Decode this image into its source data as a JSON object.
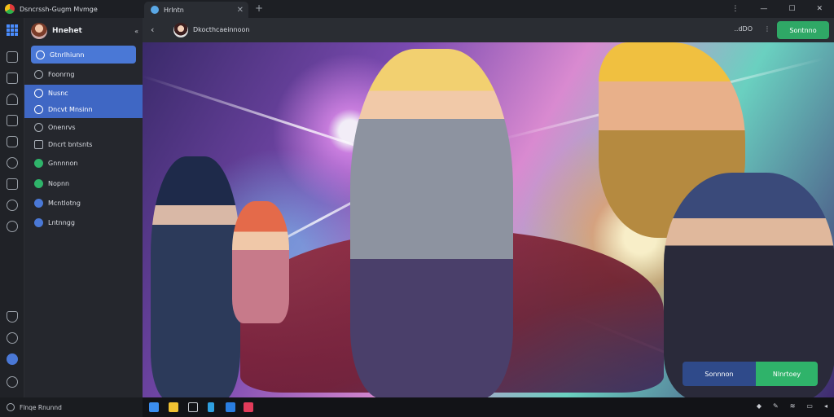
{
  "window": {
    "title": "Dsncrssh-Gugm Mvmge"
  },
  "tab": {
    "label": "Hrlntn"
  },
  "sidebar": {
    "profile_name": "Hnehet",
    "items": [
      {
        "label": "Gtnrlhiunn",
        "state": "selected",
        "icon": "home-icon"
      },
      {
        "label": "Foonrng",
        "state": "normal",
        "icon": "refresh-icon"
      },
      {
        "label": "Nusnc",
        "state": "highlight",
        "icon": "music-icon"
      },
      {
        "label": "Dncvt Mnsinn",
        "state": "highlight",
        "icon": "video-icon"
      },
      {
        "label": "Onenrvs",
        "state": "normal",
        "icon": "tag-icon"
      },
      {
        "label": "Dncrt bntsnts",
        "state": "normal",
        "icon": "square-icon"
      },
      {
        "label": "Gnnnnon",
        "state": "normal",
        "icon": "green-circle-icon"
      },
      {
        "label": "Nopnn",
        "state": "normal",
        "icon": "green-circle-icon"
      },
      {
        "label": "Mcntlotng",
        "state": "normal",
        "icon": "blue-circle-icon"
      },
      {
        "label": "Lntnngg",
        "state": "normal",
        "icon": "blue-circle-icon"
      }
    ]
  },
  "header": {
    "title": "Dkocthcaeinnoon",
    "right_text": "..dDO",
    "action_label": "Sontnno"
  },
  "overlay": {
    "blue_label": "Sonnnon",
    "green_label": "Nlnrtoey"
  },
  "status": {
    "text": "Flnqe Rnunnd"
  },
  "colors": {
    "accent_blue": "#4a78d6",
    "accent_green": "#2fb36a",
    "dark_bg": "#25272d"
  }
}
